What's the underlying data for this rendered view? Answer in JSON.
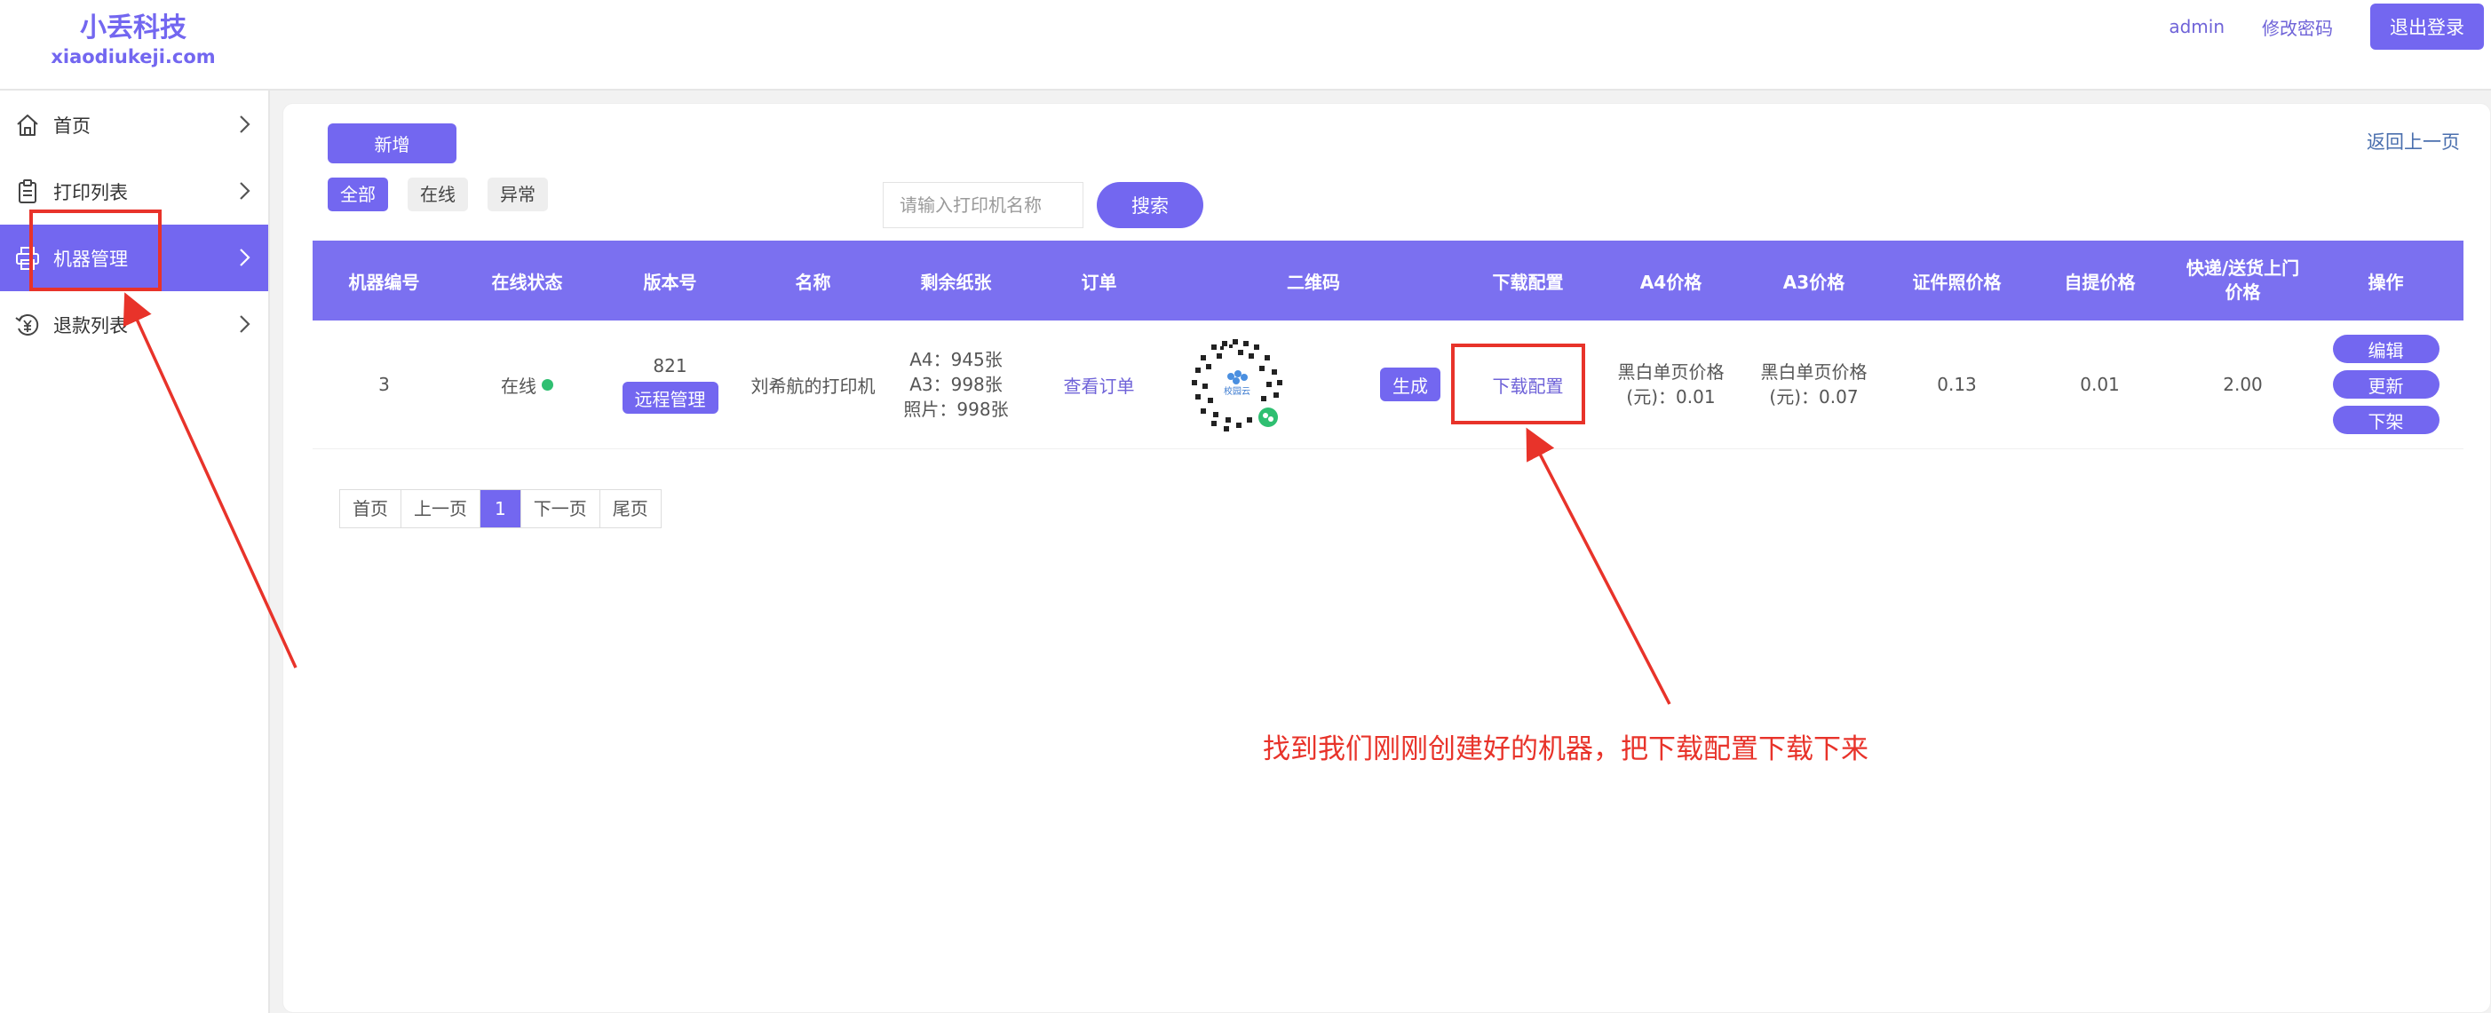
{
  "brand": {
    "name": "小丢科技",
    "domain": "xiaodiukeji.com"
  },
  "header": {
    "user": "admin",
    "change_password": "修改密码",
    "logout": "退出登录"
  },
  "sidebar": {
    "items": [
      {
        "label": "首页",
        "icon": "home-icon",
        "active": false
      },
      {
        "label": "打印列表",
        "icon": "clipboard-icon",
        "active": false
      },
      {
        "label": "机器管理",
        "icon": "printer-icon",
        "active": true
      },
      {
        "label": "退款列表",
        "icon": "refund-icon",
        "active": false
      }
    ]
  },
  "toolbar": {
    "add_label": "新增",
    "back_label": "返回上一页",
    "filters": [
      "全部",
      "在线",
      "异常"
    ],
    "active_filter": "全部",
    "search_placeholder": "请输入打印机名称",
    "search_label": "搜索"
  },
  "table": {
    "headers": {
      "id": "机器编号",
      "status": "在线状态",
      "version": "版本号",
      "name": "名称",
      "paper": "剩余纸张",
      "orders": "订单",
      "qr": "二维码",
      "download": "下载配置",
      "a4": "A4价格",
      "a3": "A3价格",
      "photo": "证件照价格",
      "pickup": "自提价格",
      "delivery": "快递/送货上门价格",
      "ops": "操作"
    },
    "rows": [
      {
        "id": "3",
        "status": "在线",
        "version": "821",
        "remote_label": "远程管理",
        "name": "刘希航的打印机",
        "paper_a4": "A4：945张",
        "paper_a3": "A3：998张",
        "paper_photo": "照片：998张",
        "orders_link": "查看订单",
        "qr_center_text": "校园云",
        "generate_label": "生成",
        "download_link": "下载配置",
        "a4_line1": "黑白单页价格",
        "a4_line2": "(元)：0.01",
        "a3_line1": "黑白单页价格",
        "a3_line2": "(元)：0.07",
        "photo_price": "0.13",
        "pickup_price": "0.01",
        "delivery_price": "2.00",
        "ops": {
          "edit": "编辑",
          "update": "更新",
          "offline": "下架"
        }
      }
    ]
  },
  "pagination": {
    "first": "首页",
    "prev": "上一页",
    "current": "1",
    "next": "下一页",
    "last": "尾页"
  },
  "annotation": {
    "note": "找到我们刚刚创建好的机器，把下载配置下载下来",
    "color": "#e8332a"
  },
  "colors": {
    "accent": "#7367f0",
    "online": "#2fbf71"
  }
}
